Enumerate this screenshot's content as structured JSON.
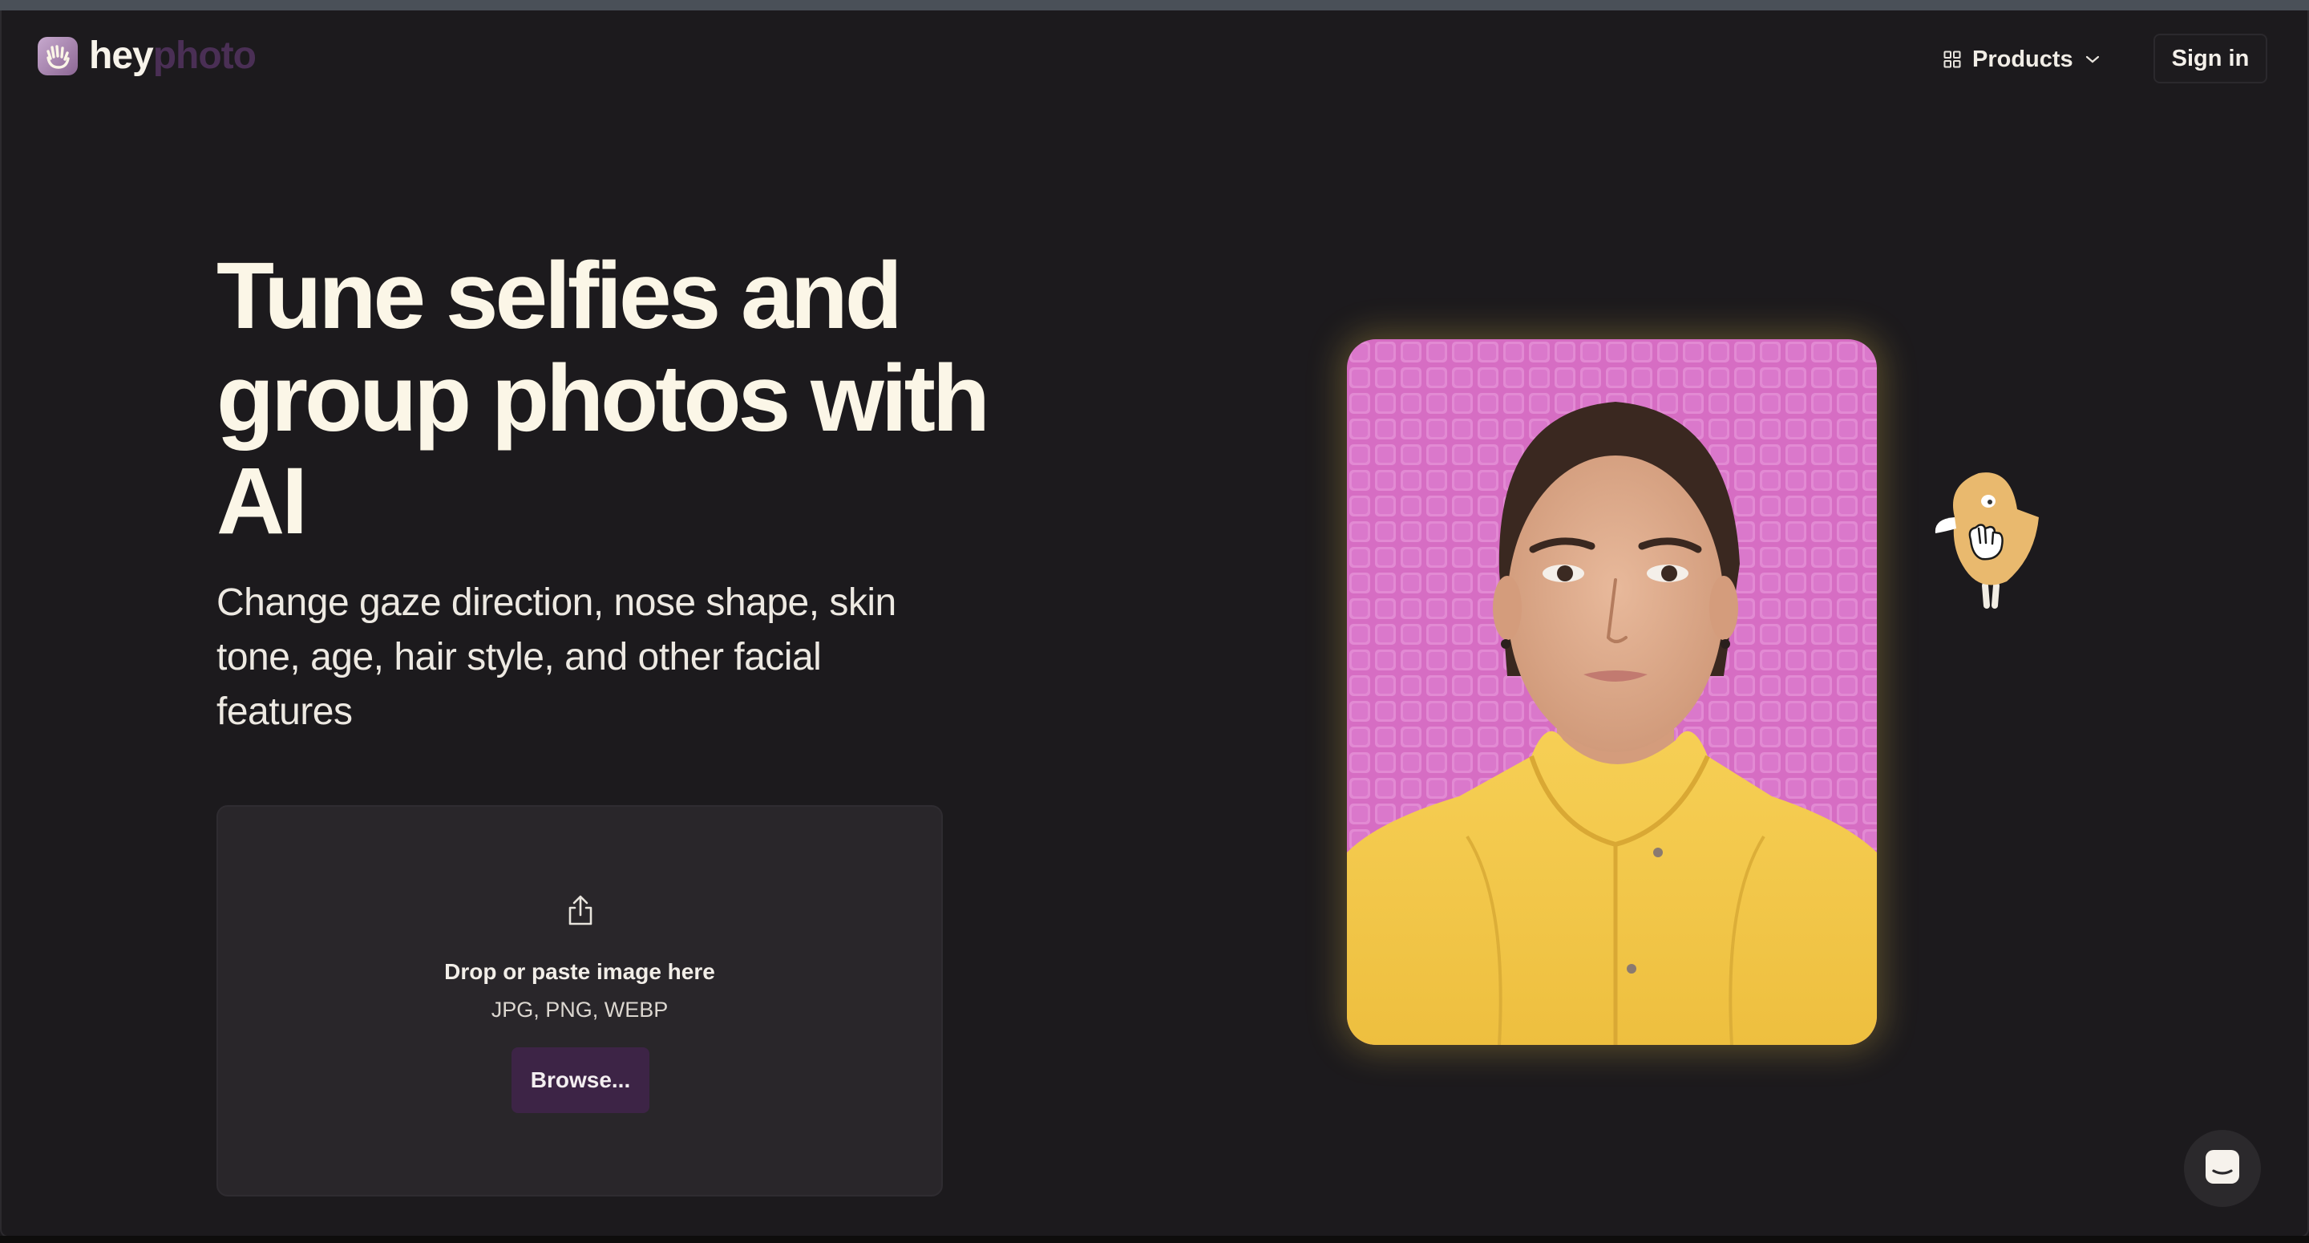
{
  "brand": {
    "name_part1": "hey",
    "name_part2": "photo",
    "logo_icon": "hand-wave-icon"
  },
  "nav": {
    "products_label": "Products",
    "products_icon": "grid-icon",
    "products_chevron": "chevron-down-icon",
    "signin_label": "Sign in"
  },
  "hero": {
    "title": "Tune selfies and group photos with AI",
    "subtitle": "Change gaze direction, nose shape, skin tone, age, hair style, and other facial features"
  },
  "upload": {
    "icon": "share-upload-icon",
    "title": "Drop or paste image here",
    "formats": "JPG, PNG, WEBP",
    "browse_label": "Browse..."
  },
  "preview": {
    "subject": "woman-portrait",
    "background_color": "#d870c4",
    "jacket_color": "#f3c84a"
  },
  "mascot": {
    "icon": "bird-mascot-icon"
  },
  "chat": {
    "icon": "chat-bubble-icon"
  },
  "colors": {
    "background": "#1c1a1d",
    "heading": "#fbf6e7",
    "button_primary": "#3d2446",
    "dropzone": "#29262a"
  }
}
